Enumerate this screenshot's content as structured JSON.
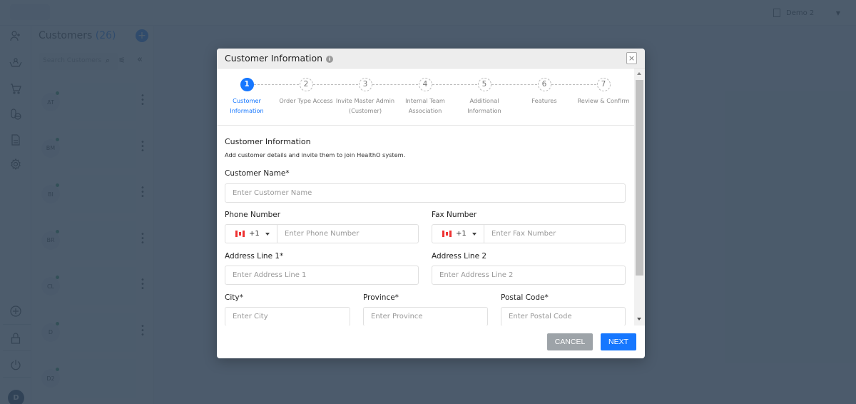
{
  "background": {
    "org_selector": {
      "label": "Demo 2",
      "icon": "building-icon",
      "caret": "chevron-down-icon"
    },
    "rail": {
      "top_icons": [
        "add-user-icon",
        "team-icon",
        "cart-icon",
        "pills-icon",
        "document-icon",
        "gear-icon"
      ],
      "bottom_icons": [
        "add-circle-icon",
        "lock-icon",
        "power-icon"
      ],
      "avatar_initial": "D"
    },
    "customers_panel": {
      "title": "Customers",
      "count": "(26)",
      "search_placeholder": "Search Customers",
      "customers": [
        {
          "initials": "AT"
        },
        {
          "initials": "BM"
        },
        {
          "initials": "BI"
        },
        {
          "initials": "BR"
        },
        {
          "initials": "CL"
        },
        {
          "initials": "D"
        },
        {
          "initials": "D2"
        }
      ]
    }
  },
  "modal": {
    "title": "Customer Information",
    "close_label": "×",
    "steps": [
      {
        "number": "1",
        "label": "Customer Information",
        "active": true
      },
      {
        "number": "2",
        "label": "Order Type Access",
        "active": false
      },
      {
        "number": "3",
        "label": "Invite Master Admin (Customer)",
        "active": false
      },
      {
        "number": "4",
        "label": "Internal Team Association",
        "active": false
      },
      {
        "number": "5",
        "label": "Additional Information",
        "active": false
      },
      {
        "number": "6",
        "label": "Features",
        "active": false
      },
      {
        "number": "7",
        "label": "Review & Confirm",
        "active": false
      }
    ],
    "section_title": "Customer Information",
    "section_desc": "Add customer details and invite them to join HealthO system.",
    "fields": {
      "customer_name": {
        "label": "Customer Name*",
        "placeholder": "Enter Customer Name",
        "value": ""
      },
      "phone": {
        "label": "Phone Number",
        "country_code": "+1",
        "flag": "canada-flag-icon",
        "placeholder": "Enter Phone Number",
        "value": ""
      },
      "fax": {
        "label": "Fax Number",
        "country_code": "+1",
        "flag": "canada-flag-icon",
        "placeholder": "Enter Fax Number",
        "value": ""
      },
      "address1": {
        "label": "Address Line 1*",
        "placeholder": "Enter Address Line 1",
        "value": ""
      },
      "address2": {
        "label": "Address Line 2",
        "placeholder": "Enter Address Line 2",
        "value": ""
      },
      "city": {
        "label": "City*",
        "placeholder": "Enter City",
        "value": ""
      },
      "province": {
        "label": "Province*",
        "placeholder": "Enter Province",
        "value": ""
      },
      "postal": {
        "label": "Postal Code*",
        "placeholder": "Enter Postal Code",
        "value": ""
      }
    },
    "buttons": {
      "cancel": "CANCEL",
      "next": "NEXT"
    },
    "colors": {
      "accent": "#1677ff",
      "cancel": "#9da3a8"
    }
  }
}
